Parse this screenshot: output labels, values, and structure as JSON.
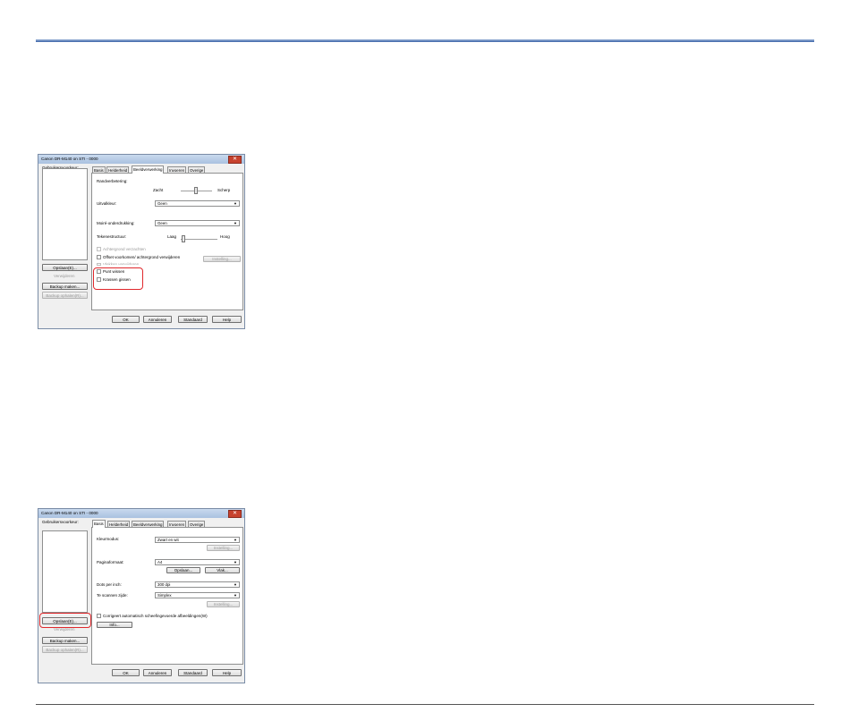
{
  "dialog1": {
    "title": "Canon DR-M140 on STI - 0000",
    "close": "✕",
    "presets_label": "Gebruikersvoorkeur:",
    "tabs": [
      "Basis",
      "Helderheid",
      "Beeldverwerking",
      "Invoeren",
      "Overige"
    ],
    "edge_label": "Randverbetering:",
    "edge_soft": "Zacht",
    "edge_sharp": "Scherp",
    "dropout_label": "Uitvalkleur:",
    "dropout_value": "Geen",
    "moire_label": "Moiré-onderdrukking:",
    "moire_value": "Geen",
    "contrast_label": "Tekenestructuur:",
    "contrast_low": "Laag",
    "contrast_high": "Hoog",
    "bg_smooth": "Achtergrond verzachten",
    "offset": "Offset voorkomen/ achtergrond verwijderen",
    "settings_btn": "Instelling...",
    "partial_line": "Vlekken verwijderen",
    "punch_holes": "Punt wissen",
    "notch": "Krassen gissen",
    "save_btn": "Opslaan(E)...",
    "delete_btn": "Verwijderen",
    "backup_btn": "Backup maken...",
    "restore_btn": "Backup ophalen(R)...",
    "ok": "OK",
    "cancel": "Annuleren",
    "default": "Standaard",
    "help": "Help"
  },
  "dialog2": {
    "title": "Canon DR-M140 on STI - 0000",
    "close": "✕",
    "presets_label": "Gebruikersvoorkeur:",
    "tabs": [
      "Basis",
      "Helderheid",
      "Beeldverwerking",
      "Invoeren",
      "Overige"
    ],
    "mode_label": "Kleurmodus:",
    "mode_value": "Zwart en wit",
    "settings_btn": "Instelling...",
    "page_size_label": "Paginaformaat:",
    "page_size_value": "A4",
    "save_btn": "Opslaan...",
    "area_btn": "Vlak...",
    "dpi_label": "Dots per inch:",
    "dpi_value": "300 dpi",
    "side_label": "Te scannen zijde:",
    "side_value": "Simplex",
    "settings_btn2": "Instelling...",
    "straighten": "Corrigeert automatisch scheefingevoerde afbeeldingen(W)",
    "info_btn": "Info...",
    "save_preset_btn": "Opslaan(E)...",
    "delete_btn": "Verwijderen",
    "backup_btn": "Backup maken...",
    "restore_btn": "Backup ophalen(R)...",
    "ok": "OK",
    "cancel": "Annuleren",
    "default": "Standaard",
    "help": "Help"
  },
  "colors": {
    "highlight": "#e0282c",
    "rule": "#3a63a8"
  }
}
